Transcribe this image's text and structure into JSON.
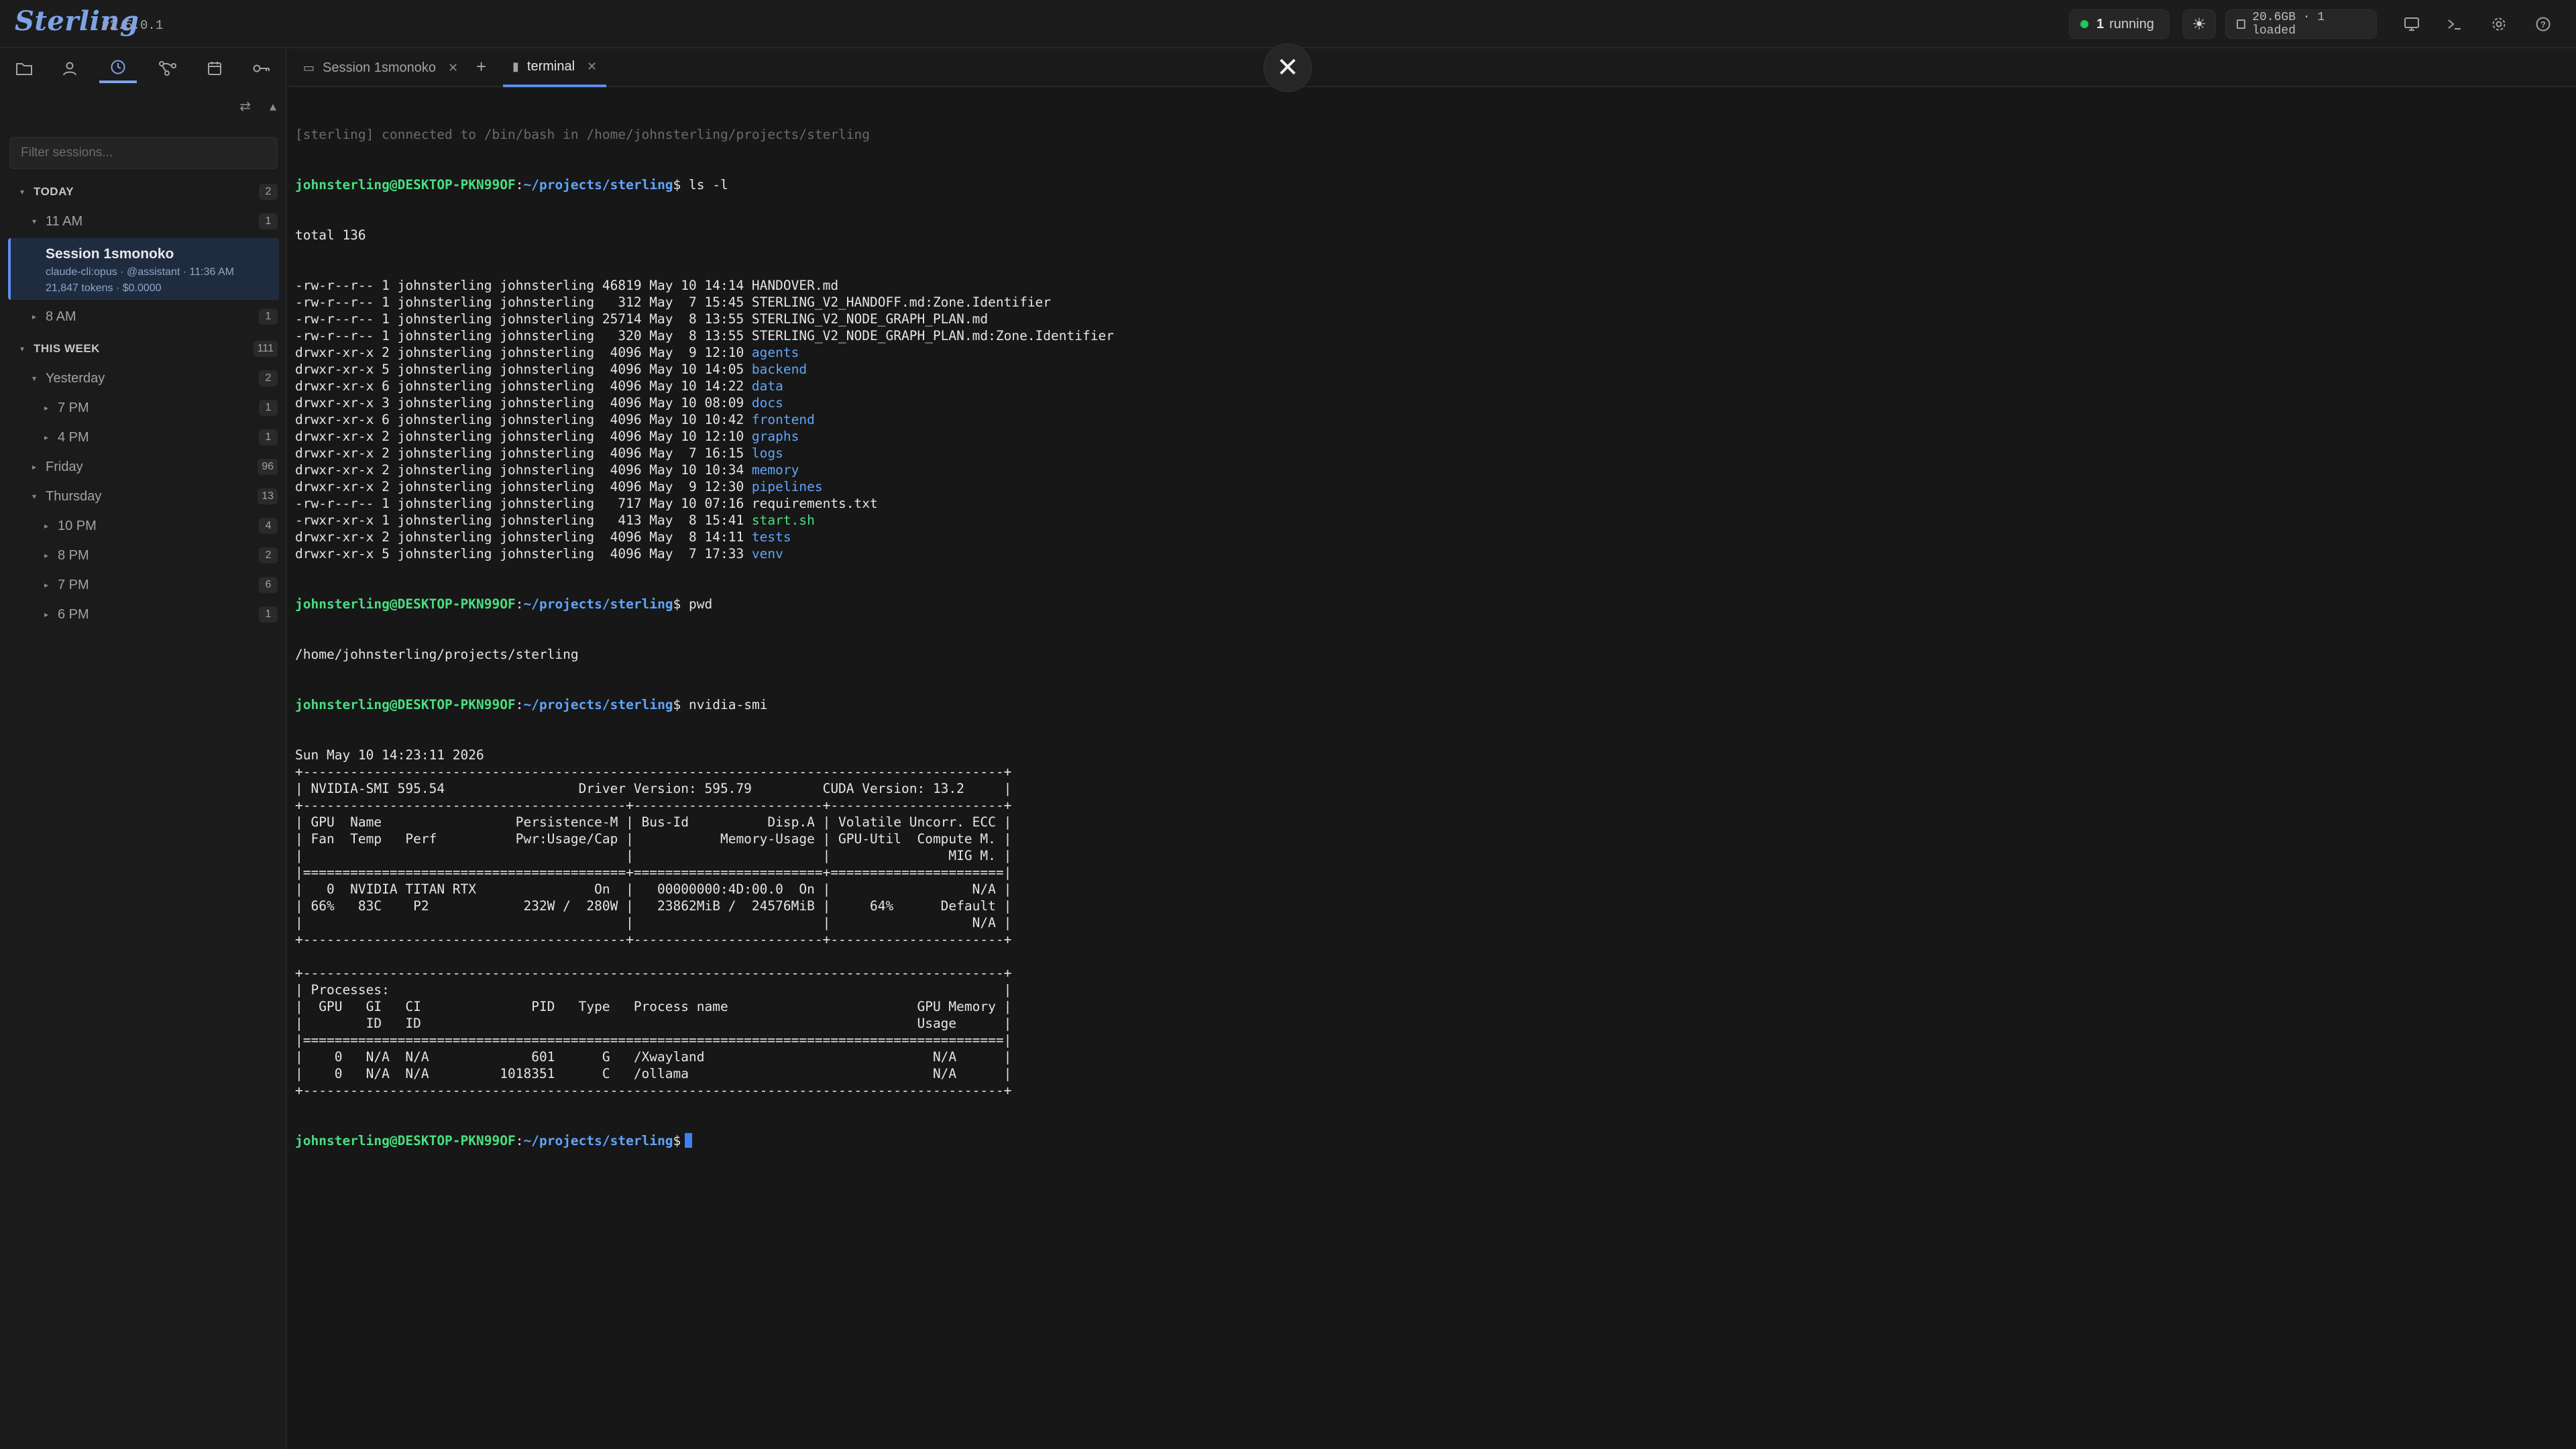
{
  "app": {
    "name": "Sterling",
    "version": "v2.5.0.1"
  },
  "topbar": {
    "running_count": "1",
    "running_label": "running",
    "theme_icon": "sun-icon",
    "memory": "20.6GB · 1 loaded"
  },
  "sidebar": {
    "filter_placeholder": "Filter sessions...",
    "today": {
      "label": "TODAY",
      "count": "2"
    },
    "eleven_am": {
      "label": "11 AM",
      "count": "1"
    },
    "active_session": {
      "title": "Session 1smonoko",
      "meta": "claude-cli:opus · @assistant · 11:36 AM",
      "usage": "21,847 tokens · $0.0000"
    },
    "eight_am": {
      "label": "8 AM",
      "count": "1"
    },
    "this_week": {
      "label": "THIS WEEK",
      "count": "111"
    },
    "yesterday": {
      "label": "Yesterday",
      "count": "2"
    },
    "yesterday_7pm": {
      "label": "7 PM",
      "count": "1"
    },
    "yesterday_4pm": {
      "label": "4 PM",
      "count": "1"
    },
    "friday": {
      "label": "Friday",
      "count": "96"
    },
    "thursday": {
      "label": "Thursday",
      "count": "13"
    },
    "thu_10pm": {
      "label": "10 PM",
      "count": "4"
    },
    "thu_8pm": {
      "label": "8 PM",
      "count": "2"
    },
    "thu_7pm": {
      "label": "7 PM",
      "count": "6"
    },
    "thu_6pm": {
      "label": "6 PM",
      "count": "1"
    }
  },
  "tabs": [
    {
      "label": "Session 1smonoko"
    },
    {
      "label": "terminal"
    }
  ],
  "terminal": {
    "prompt_user": "johnsterling@DESKTOP-PKN99OF",
    "prompt_path": "~/projects/sterling",
    "connect_msg": "[sterling] connected to /bin/bash in /home/johnsterling/projects/sterling",
    "cmd_ls": "ls -l",
    "total": "total 136",
    "ls_rows": [
      {
        "meta": "-rw-r--r-- 1 johnsterling johnsterling 46819 May 10 14:14 ",
        "name": "HANDOVER.md",
        "kind": "file"
      },
      {
        "meta": "-rw-r--r-- 1 johnsterling johnsterling   312 May  7 15:45 ",
        "name": "STERLING_V2_HANDOFF.md:Zone.Identifier",
        "kind": "file"
      },
      {
        "meta": "-rw-r--r-- 1 johnsterling johnsterling 25714 May  8 13:55 ",
        "name": "STERLING_V2_NODE_GRAPH_PLAN.md",
        "kind": "file"
      },
      {
        "meta": "-rw-r--r-- 1 johnsterling johnsterling   320 May  8 13:55 ",
        "name": "STERLING_V2_NODE_GRAPH_PLAN.md:Zone.Identifier",
        "kind": "file"
      },
      {
        "meta": "drwxr-xr-x 2 johnsterling johnsterling  4096 May  9 12:10 ",
        "name": "agents",
        "kind": "dir"
      },
      {
        "meta": "drwxr-xr-x 5 johnsterling johnsterling  4096 May 10 14:05 ",
        "name": "backend",
        "kind": "dir"
      },
      {
        "meta": "drwxr-xr-x 6 johnsterling johnsterling  4096 May 10 14:22 ",
        "name": "data",
        "kind": "dir"
      },
      {
        "meta": "drwxr-xr-x 3 johnsterling johnsterling  4096 May 10 08:09 ",
        "name": "docs",
        "kind": "dir"
      },
      {
        "meta": "drwxr-xr-x 6 johnsterling johnsterling  4096 May 10 10:42 ",
        "name": "frontend",
        "kind": "dir"
      },
      {
        "meta": "drwxr-xr-x 2 johnsterling johnsterling  4096 May 10 12:10 ",
        "name": "graphs",
        "kind": "dir"
      },
      {
        "meta": "drwxr-xr-x 2 johnsterling johnsterling  4096 May  7 16:15 ",
        "name": "logs",
        "kind": "dir"
      },
      {
        "meta": "drwxr-xr-x 2 johnsterling johnsterling  4096 May 10 10:34 ",
        "name": "memory",
        "kind": "dir"
      },
      {
        "meta": "drwxr-xr-x 2 johnsterling johnsterling  4096 May  9 12:30 ",
        "name": "pipelines",
        "kind": "dir"
      },
      {
        "meta": "-rw-r--r-- 1 johnsterling johnsterling   717 May 10 07:16 ",
        "name": "requirements.txt",
        "kind": "file"
      },
      {
        "meta": "-rwxr-xr-x 1 johnsterling johnsterling   413 May  8 15:41 ",
        "name": "start.sh",
        "kind": "exe"
      },
      {
        "meta": "drwxr-xr-x 2 johnsterling johnsterling  4096 May  8 14:11 ",
        "name": "tests",
        "kind": "dir"
      },
      {
        "meta": "drwxr-xr-x 5 johnsterling johnsterling  4096 May  7 17:33 ",
        "name": "venv",
        "kind": "dir"
      }
    ],
    "cmd_pwd": "pwd",
    "pwd_output": "/home/johnsterling/projects/sterling",
    "cmd_nvidia": "nvidia-smi",
    "smi_lines": [
      "Sun May 10 14:23:11 2026",
      "+-----------------------------------------------------------------------------------------+",
      "| NVIDIA-SMI 595.54                 Driver Version: 595.79         CUDA Version: 13.2     |",
      "+-----------------------------------------+------------------------+----------------------+",
      "| GPU  Name                 Persistence-M | Bus-Id          Disp.A | Volatile Uncorr. ECC |",
      "| Fan  Temp   Perf          Pwr:Usage/Cap |           Memory-Usage | GPU-Util  Compute M. |",
      "|                                         |                        |               MIG M. |",
      "|=========================================+========================+======================|",
      "|   0  NVIDIA TITAN RTX               On  |   00000000:4D:00.0  On |                  N/A |",
      "| 66%   83C    P2            232W /  280W |   23862MiB /  24576MiB |     64%      Default |",
      "|                                         |                        |                  N/A |",
      "+-----------------------------------------+------------------------+----------------------+",
      "",
      "+-----------------------------------------------------------------------------------------+",
      "| Processes:                                                                              |",
      "|  GPU   GI   CI              PID   Type   Process name                        GPU Memory |",
      "|        ID   ID                                                               Usage      |",
      "|=========================================================================================|",
      "|    0   N/A  N/A             601      G   /Xwayland                             N/A      |",
      "|    0   N/A  N/A         1018351      C   /ollama                               N/A      |",
      "+-----------------------------------------------------------------------------------------+"
    ]
  }
}
